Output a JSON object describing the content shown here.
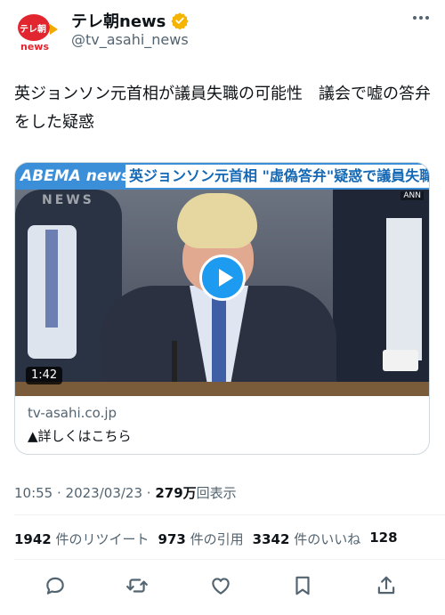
{
  "account": {
    "display_name": "テレ朝news",
    "handle": "@tv_asahi_news",
    "logo_text_jp": "テレ朝",
    "logo_text_en": "news",
    "verified_color": "#f4b400"
  },
  "tweet": {
    "text": "英ジョンソン元首相が議員失職の可能性　議会で嘘の答弁をした疑惑"
  },
  "card": {
    "banner_brand": "ABEMA news/",
    "banner_headline": "英ジョンソン元首相 \"虚偽答弁\"疑惑で議員失職も",
    "watermark": "NEWS",
    "corner_logo": "ANN",
    "duration": "1:42",
    "domain": "tv-asahi.co.jp",
    "title": "▲詳しくはこちら"
  },
  "meta": {
    "time": "10:55",
    "date": "2023/03/23",
    "separator": " · ",
    "views_count": "279万",
    "views_label": "回表示"
  },
  "stats": {
    "retweets_count": "1942",
    "retweets_label": "件のリツイート",
    "quotes_count": "973",
    "quotes_label": "件の引用",
    "likes_count": "3342",
    "likes_label": "件のいいね",
    "bookmarks_count": "128"
  },
  "actions": [
    "reply-icon",
    "retweet-icon",
    "like-icon",
    "bookmark-icon",
    "share-icon"
  ],
  "colors": {
    "accent": "#1d9bf0",
    "secondary_text": "#536471",
    "brand_red": "#e1262f",
    "banner_blue": "#3b8fd9"
  }
}
